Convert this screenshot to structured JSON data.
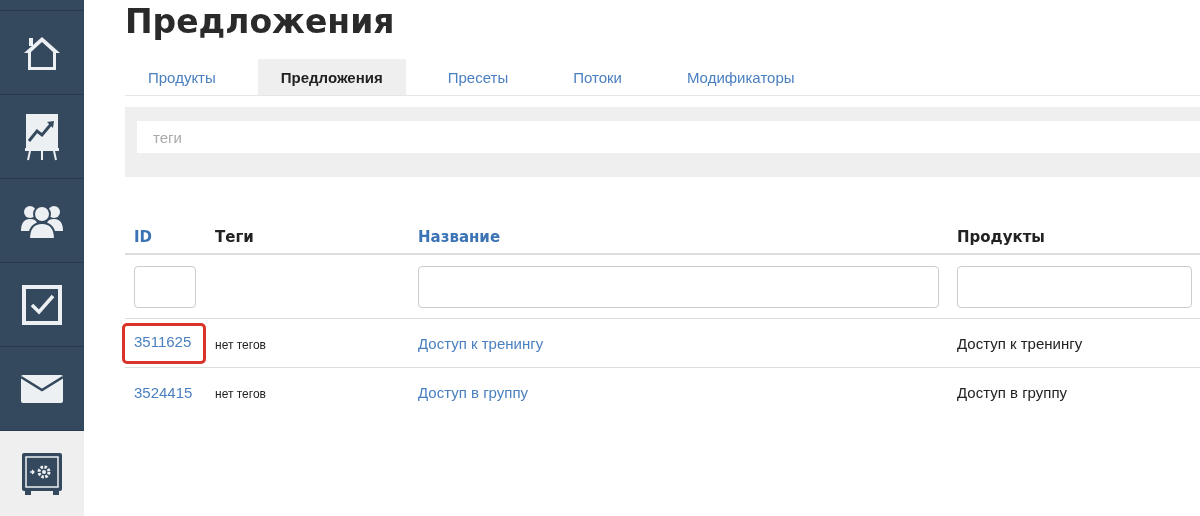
{
  "sidebar": {
    "items": [
      {
        "kind": "home",
        "selected": false
      },
      {
        "kind": "chart",
        "selected": false
      },
      {
        "kind": "users",
        "selected": false
      },
      {
        "kind": "tasks",
        "selected": false
      },
      {
        "kind": "mail",
        "selected": false
      },
      {
        "kind": "safe",
        "selected": true
      }
    ]
  },
  "title": "Предложения",
  "tabs": [
    {
      "label": "Продукты",
      "selected": false
    },
    {
      "label": "Предложения",
      "selected": true
    },
    {
      "label": "Пресеты",
      "selected": false
    },
    {
      "label": "Потоки",
      "selected": false
    },
    {
      "label": "Модификаторы",
      "selected": false
    }
  ],
  "tag_filter": {
    "placeholder": "теги"
  },
  "table": {
    "columns": [
      {
        "label": "ID",
        "sortable": true,
        "filter": true
      },
      {
        "label": "Теги",
        "sortable": false,
        "filter": false
      },
      {
        "label": "Название",
        "sortable": true,
        "filter": true
      },
      {
        "label": "Продукты",
        "sortable": false,
        "filter": true
      }
    ],
    "rows": [
      {
        "id": "3511625",
        "tags": "нет тегов",
        "name": "Доступ к тренингу",
        "products": "Доступ к тренингу",
        "highlighted": true
      },
      {
        "id": "3524415",
        "tags": "нет тегов",
        "name": "Доступ в группу",
        "products": "Доступ в группу",
        "highlighted": false
      }
    ]
  }
}
